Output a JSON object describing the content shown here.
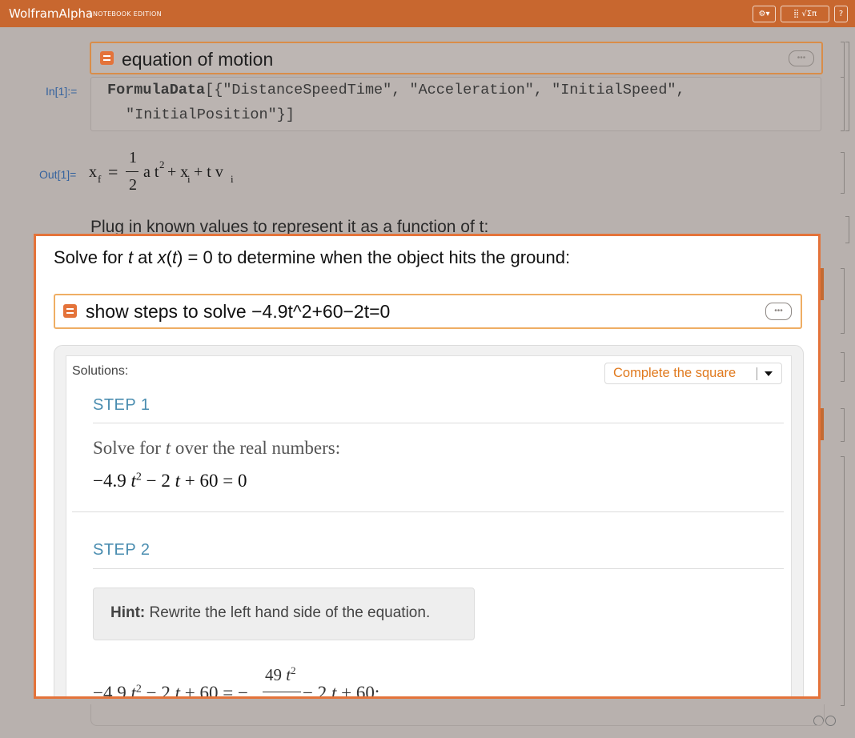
{
  "app": {
    "brand": "WolframAlpha",
    "edition": "NOTEBOOK EDITION",
    "settings_button": "⚙▾",
    "palette_button": "⣿ √Σπ",
    "help_button": "?"
  },
  "notebook": {
    "input_cell": {
      "text": "equation of motion",
      "more_button": "•••"
    },
    "in_label": "In[1]:=",
    "code": {
      "fn": "FormulaData",
      "line1_args": "[{\"DistanceSpeedTime\", \"Acceleration\", \"InitialSpeed\",",
      "line2": "\"InitialPosition\"}]"
    },
    "out_label": "Out[1]=",
    "output_formula": {
      "lhs": "x",
      "lhs_sub": "f",
      "eq": "=",
      "num": "1",
      "den": "2",
      "term1": "a t",
      "term1_sup": "2",
      "plus1": "+ x",
      "sub_i1": "i",
      "plus2": "+ t v",
      "sub_i2": "i"
    },
    "plug_text": "Plug in known values to represent it as a function of t:"
  },
  "overlay": {
    "solve_text_a": "Solve for ",
    "solve_t": "t",
    "solve_text_b": " at ",
    "solve_x": "x",
    "solve_text_c": "(",
    "solve_t2": "t",
    "solve_text_d": ") = 0 to determine when the object hits the ground:",
    "input_text": "show steps to solve −4.9t^2+60−2t=0",
    "more_button": "•••",
    "solutions_label": "Solutions:",
    "method_dropdown": "Complete the square",
    "step1": {
      "label": "STEP 1",
      "desc_a": "Solve for ",
      "desc_t": "t",
      "desc_b": " over the real numbers:",
      "eq_a": "−4.9 ",
      "eq_t": "t",
      "eq_sup": "2",
      "eq_b": " − 2 ",
      "eq_t2": "t",
      "eq_c": " + 60 = 0"
    },
    "step2": {
      "label": "STEP 2",
      "hint_bold": "Hint:",
      "hint_text": " Rewrite the left hand side of the equation.",
      "eq_a": "−4.9 ",
      "eq_t": "t",
      "eq_sup": "2",
      "eq_b": " − 2 ",
      "eq_t2": "t",
      "eq_c": " + 60 = −",
      "frac_num": "49 ",
      "frac_t": "t",
      "frac_sup": "2",
      "eq_d": " − 2 ",
      "eq_t3": "t",
      "eq_e": " + 60:"
    }
  },
  "colors": {
    "titlebar": "#c8672f",
    "accent_orange": "#e4733a",
    "step_blue": "#4a8db0",
    "label_blue": "#34629e"
  }
}
